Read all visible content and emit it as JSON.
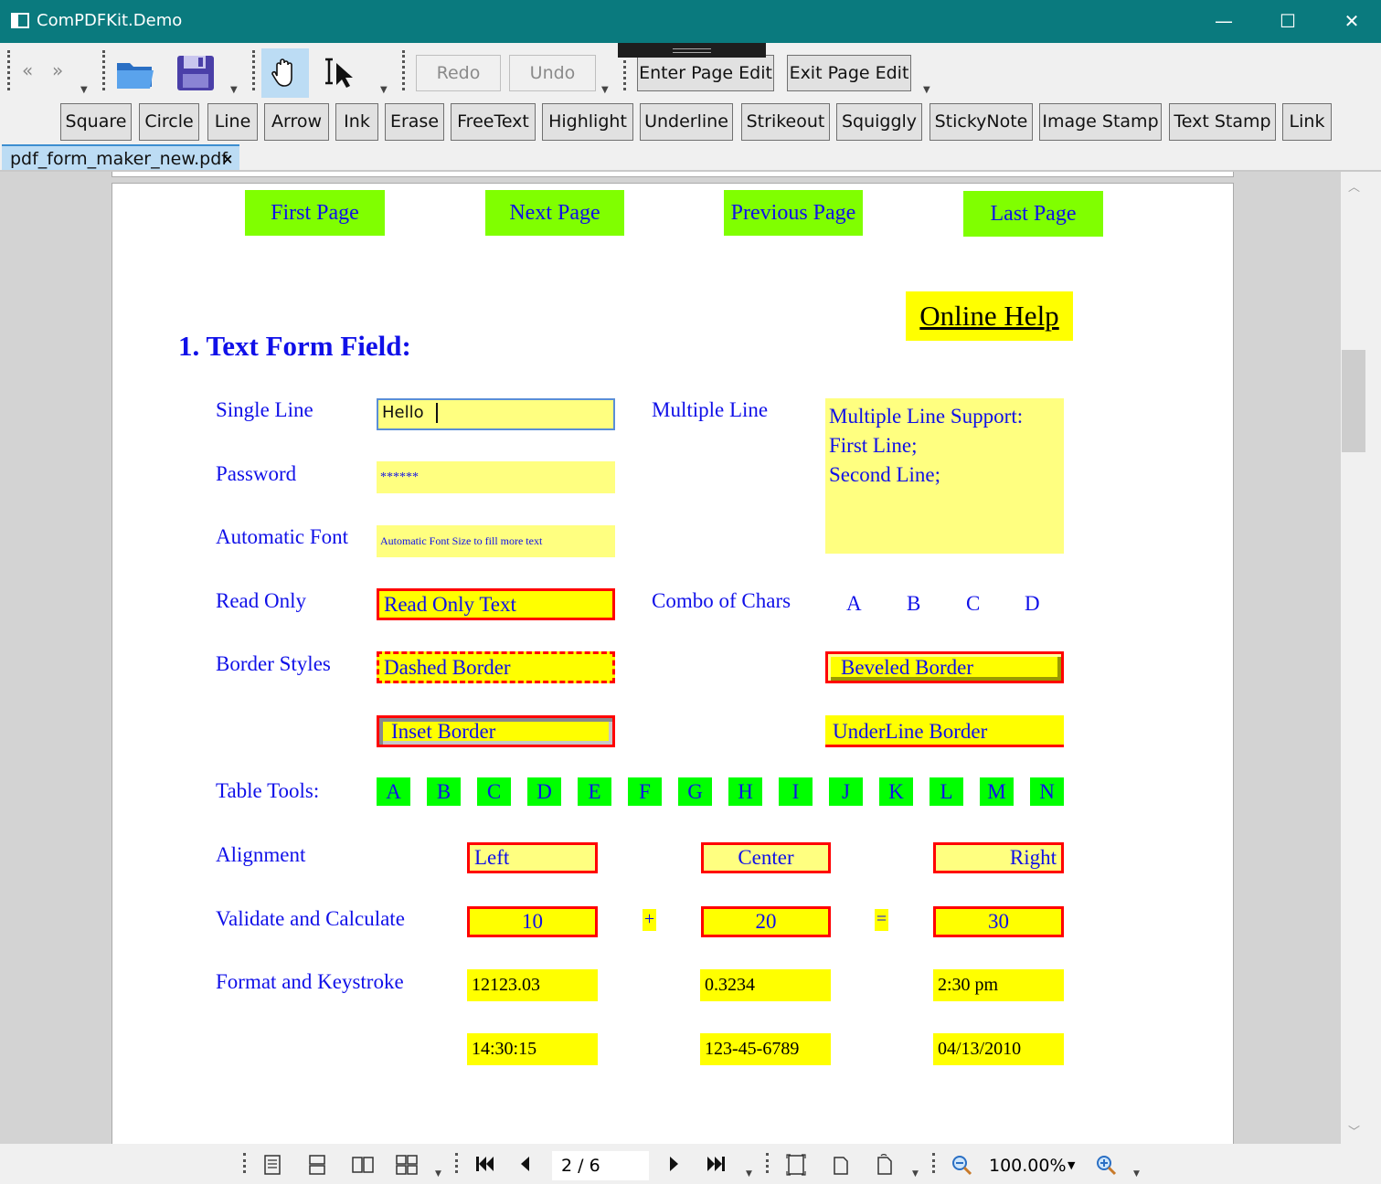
{
  "window": {
    "title": "ComPDFKit.Demo",
    "minimize": "—",
    "maximize": "☐",
    "close": "✕"
  },
  "toolbar": {
    "redo": "Redo",
    "undo": "Undo",
    "enter_page_edit": "Enter Page Edit",
    "exit_page_edit": "Exit Page Edit",
    "back_glyph": "«",
    "forward_glyph": "»"
  },
  "annotation_tools": [
    "Square",
    "Circle",
    "Line",
    "Arrow",
    "Ink",
    "Erase",
    "FreeText",
    "Highlight",
    "Underline",
    "Strikeout",
    "Squiggly",
    "StickyNote",
    "Image Stamp",
    "Text Stamp",
    "Link"
  ],
  "tab": {
    "filename": "pdf_form_maker_new.pdf",
    "close": "×"
  },
  "pdf": {
    "nav": {
      "first": "First Page",
      "next": "Next Page",
      "previous": "Previous Page",
      "last": "Last Page"
    },
    "online_help": "Online Help",
    "section_title": "1. Text Form Field:",
    "labels": {
      "single_line": "Single Line",
      "multiple_line": "Multiple Line",
      "password": "Password",
      "automatic_font": "Automatic Font",
      "read_only": "Read Only",
      "combo_of_chars": "Combo of Chars",
      "border_styles": "Border Styles",
      "table_tools": "Table Tools:",
      "alignment": "Alignment",
      "validate_calculate": "Validate and Calculate",
      "format_keystroke": "Format and Keystroke"
    },
    "fields": {
      "single_line": "Hello",
      "password": "******",
      "automatic_font": "Automatic Font Size to fill more text",
      "multiline_1": "Multiple Line Support:",
      "multiline_2": "First Line;",
      "multiline_3": "Second Line;",
      "read_only": "Read Only Text",
      "dashed": "Dashed Border",
      "beveled": "Beveled Border",
      "inset": "Inset Border",
      "underline": "UnderLine Border",
      "align_left": "Left",
      "align_center": "Center",
      "align_right": "Right",
      "calc_a": "10",
      "calc_b": "20",
      "calc_result": "30",
      "plus": "+",
      "equals": "=",
      "format_1": "12123.03",
      "format_2": "0.3234",
      "format_3": "2:30 pm",
      "format_4": "14:30:15",
      "format_5": "123-45-6789",
      "format_6": "04/13/2010"
    },
    "combo_chars": [
      "A",
      "B",
      "C",
      "D"
    ],
    "table_letters": [
      "A",
      "B",
      "C",
      "D",
      "E",
      "F",
      "G",
      "H",
      "I",
      "J",
      "K",
      "L",
      "M",
      "N"
    ]
  },
  "status": {
    "page_indicator": "2 / 6",
    "zoom": "100.00%"
  },
  "colors": {
    "titlebar": "#0a7a7e",
    "nav_green": "#80ff00",
    "table_green": "#00ff00",
    "field_yellow": "#ffff80",
    "bright_yellow": "#ffff00",
    "pdf_text_blue": "#1010e8",
    "border_red": "#ff0000"
  }
}
